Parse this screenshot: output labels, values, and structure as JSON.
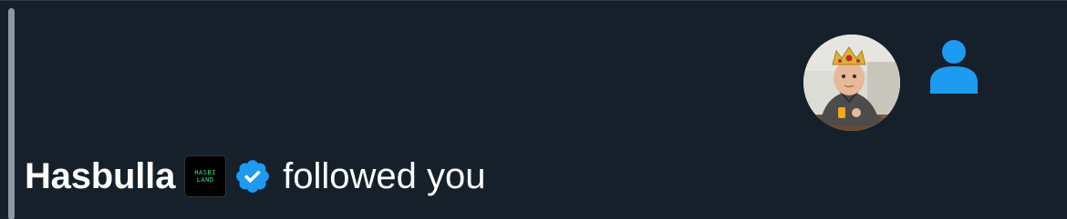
{
  "notification": {
    "user_name": "Hasbulla",
    "action_text": "followed you",
    "logo_lines": [
      "HASBI",
      "LAND"
    ],
    "colors": {
      "background": "#15202b",
      "accent": "#1d9bf0",
      "logo_text": "#35e08a"
    },
    "icons": {
      "type_icon": "person-icon",
      "verified_icon": "verified-badge-icon"
    }
  }
}
